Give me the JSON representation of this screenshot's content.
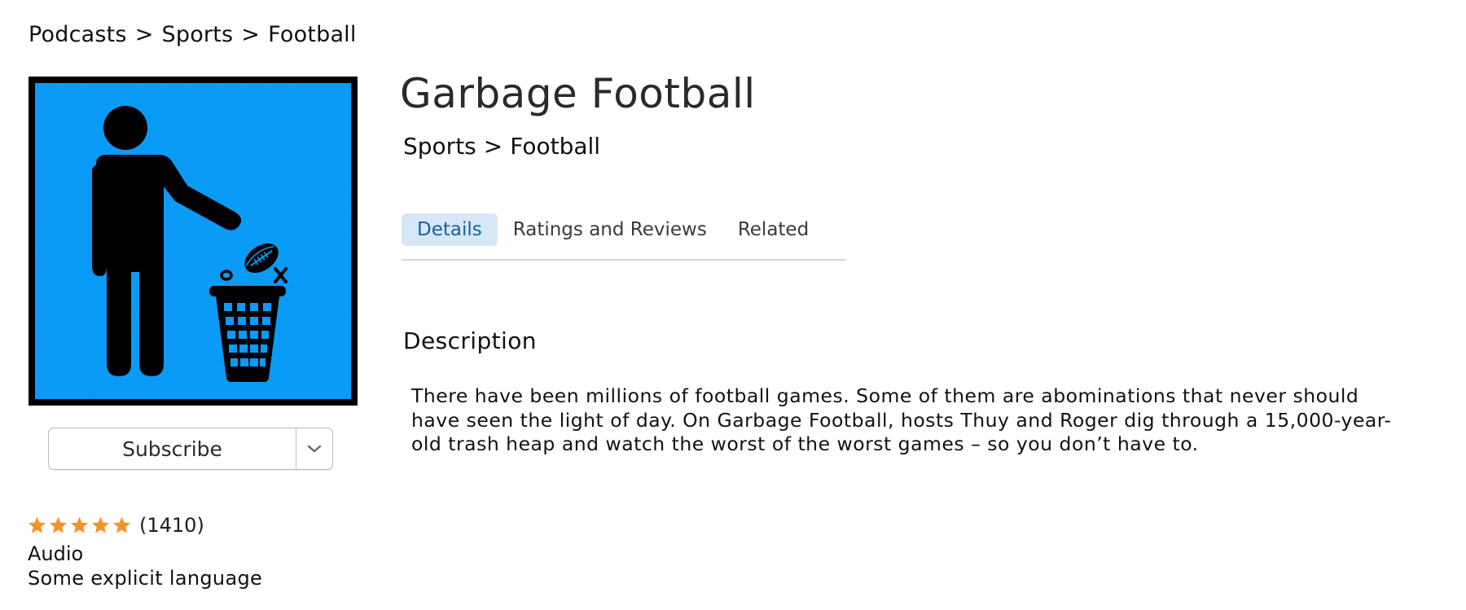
{
  "breadcrumb": {
    "items": [
      "Podcasts",
      "Sports",
      "Football"
    ],
    "separator": ">"
  },
  "podcast": {
    "title": "Garbage Football",
    "category": "Sports",
    "subcategory": "Football",
    "category_separator": ">"
  },
  "artwork": {
    "background_color": "#0a9bf7",
    "border_color": "#000000",
    "icon": "person-throwing-football-in-trash-icon"
  },
  "subscribe": {
    "label": "Subscribe",
    "menu_icon": "chevron-down-icon"
  },
  "rating": {
    "stars": 5,
    "max_stars": 5,
    "count_label": "(1410)",
    "star_color": "#f0952b"
  },
  "meta": {
    "kind": "Audio",
    "advisory": "Some explicit language"
  },
  "tabs": [
    {
      "label": "Details",
      "active": true
    },
    {
      "label": "Ratings and Reviews",
      "active": false
    },
    {
      "label": "Related",
      "active": false
    }
  ],
  "description": {
    "heading": "Description",
    "text": "There have been millions of football games. Some of them are abominations that never should have seen the light of day. On Garbage Football, hosts Thuy and Roger dig through a 15,000-year-old trash heap and watch the worst of the worst games – so you don’t have to."
  },
  "colors": {
    "active_tab_bg": "#d6e7f8",
    "active_tab_text": "#1a5f9e"
  }
}
